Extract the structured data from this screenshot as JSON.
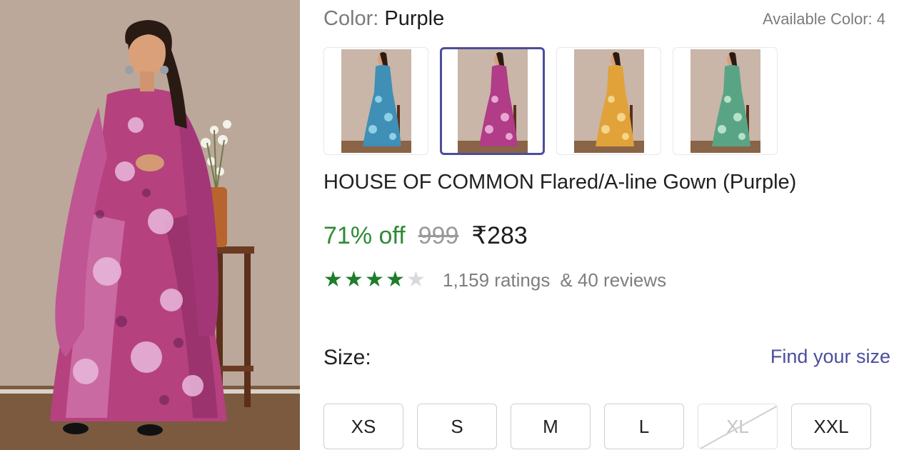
{
  "product": {
    "color_label": "Color: ",
    "color_value": "Purple",
    "available_colors": "Available Color: 4",
    "title": "HOUSE OF COMMON Flared/A-line Gown (Purple)",
    "discount": "71% off",
    "mrp": "999",
    "price": "₹283",
    "rating_value": 4,
    "rating_max": 5,
    "ratings_count": "1,159 ratings",
    "reviews_count": "& 40 reviews"
  },
  "swatches": [
    {
      "name": "blue-gown",
      "color": "#3f8fb6",
      "accent": "#8fd0e6",
      "selected": false
    },
    {
      "name": "purple-gown",
      "color": "#b13c87",
      "accent": "#e7a7d2",
      "selected": true
    },
    {
      "name": "mustard-gown",
      "color": "#e1a23a",
      "accent": "#f4d58a",
      "selected": false
    },
    {
      "name": "green-gown",
      "color": "#5aa486",
      "accent": "#b7e1c9",
      "selected": false
    }
  ],
  "size_section": {
    "label": "Size:",
    "find_link": "Find your size",
    "sizes": [
      {
        "label": "XS",
        "available": true
      },
      {
        "label": "S",
        "available": true
      },
      {
        "label": "M",
        "available": true
      },
      {
        "label": "L",
        "available": true
      },
      {
        "label": "XL",
        "available": false
      },
      {
        "label": "XXL",
        "available": true
      }
    ]
  },
  "colors": {
    "discount_green": "#2f8a36",
    "star_green": "#1f7d2b",
    "link_purple": "#4b4e9a",
    "selected_border": "#4b4e9a"
  }
}
